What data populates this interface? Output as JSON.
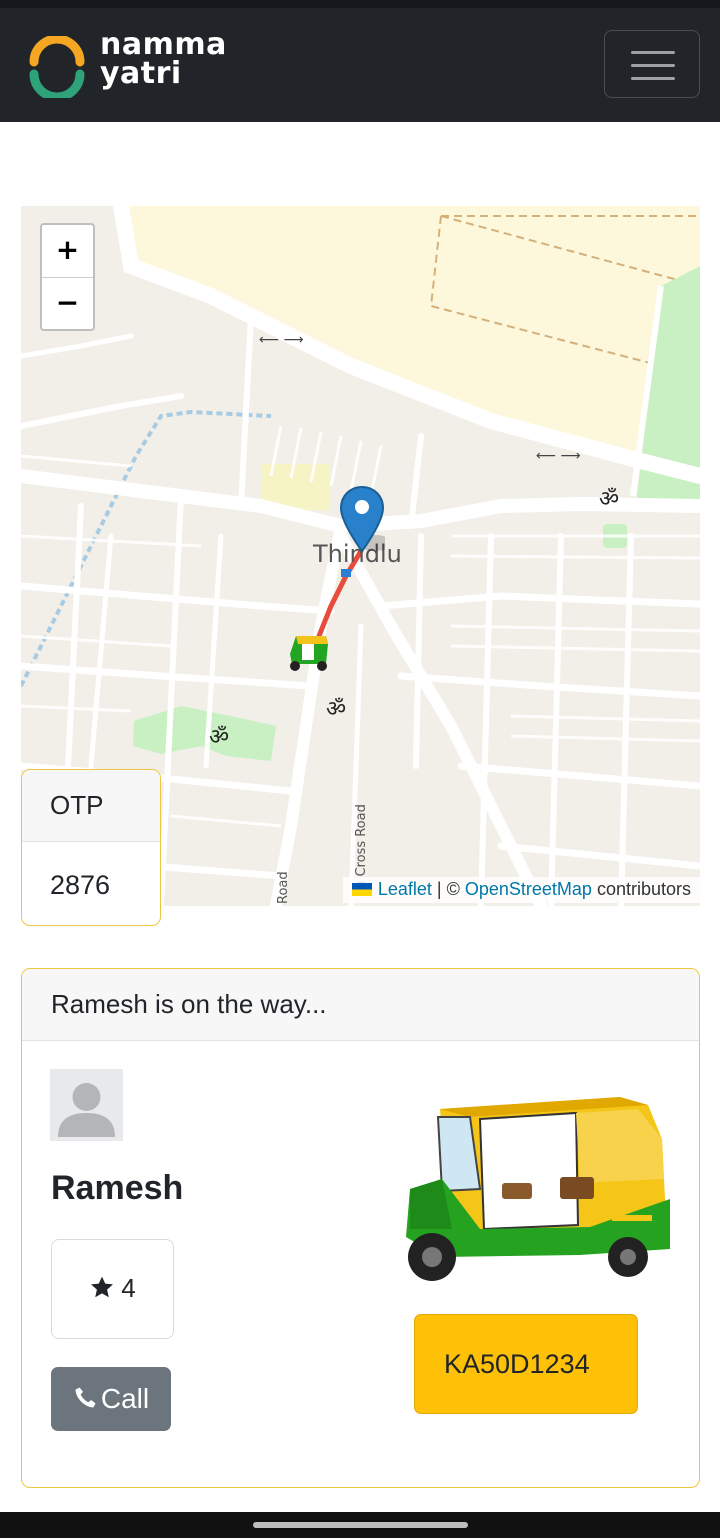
{
  "app": {
    "brand_line1": "namma",
    "brand_line2": "yatri",
    "logo_icon": "namma-yatri-logo-icon",
    "menu_icon": "hamburger-menu-icon"
  },
  "map": {
    "zoom_in": "+",
    "zoom_out": "−",
    "place_label": "Thindlu",
    "road_label_1": "th Cross Road",
    "road_label_2": "Road",
    "attribution": {
      "leaflet": "Leaflet",
      "separator": " | © ",
      "osm": "OpenStreetMap",
      "suffix": " contributors"
    }
  },
  "otp": {
    "label": "OTP",
    "value": "2876"
  },
  "ride": {
    "status": "Ramesh is on the way...",
    "driver_name": "Ramesh",
    "rating": "4",
    "call_label": "Call",
    "vehicle_number": "KA50D1234"
  },
  "colors": {
    "navbar": "#212529",
    "accent_yellow": "#ffc107",
    "card_border": "#f0c542",
    "call_button": "#6c757d",
    "link": "#0078a8",
    "route": "#e74c3c"
  }
}
